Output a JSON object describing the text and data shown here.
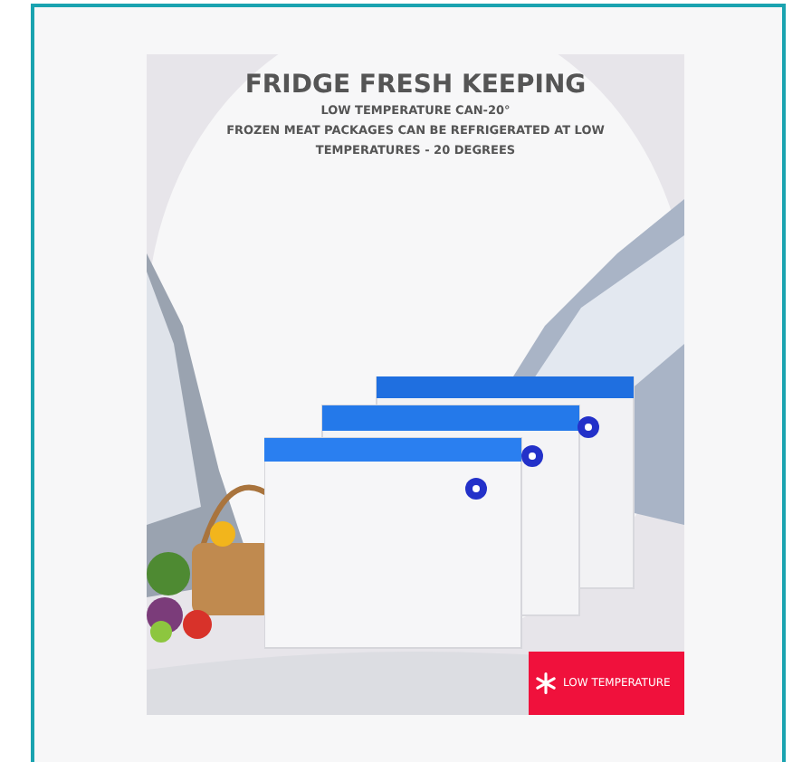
{
  "product_image": {
    "title": "FRIDGE FRESH KEEPING",
    "subtitle": "LOW TEMPERATURE CAN-20°",
    "description": "FROZEN MEAT PACKAGES CAN BE REFRIGERATED AT LOW TEMPERATURES - 20 DEGREES",
    "badge": "LOW TEMPERATURE"
  }
}
